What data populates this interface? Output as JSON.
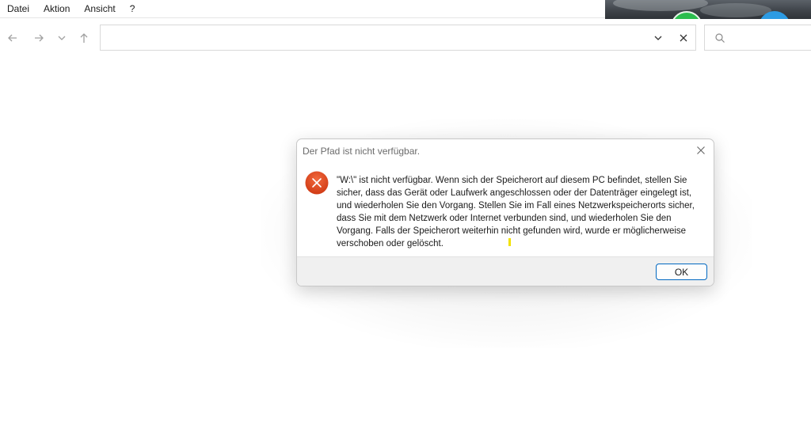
{
  "menubar": {
    "items": [
      "Datei",
      "Aktion",
      "Ansicht",
      "?"
    ]
  },
  "toolbar": {
    "back_icon": "arrow-left-icon",
    "forward_icon": "arrow-right-icon",
    "recent_icon": "chevron-down-icon",
    "up_icon": "arrow-up-icon"
  },
  "address": {
    "value": "",
    "dropdown_icon": "chevron-down-icon",
    "clear_icon": "close-icon"
  },
  "search": {
    "value": "",
    "icon": "search-icon"
  },
  "dialog": {
    "title": "Der Pfad ist nicht verfügbar.",
    "close_icon": "close-icon",
    "icon": "error-icon",
    "message": "\"W:\\\" ist nicht verfügbar. Wenn sich der Speicherort auf diesem PC befindet, stellen Sie sicher, dass das Gerät oder Laufwerk angeschlossen oder der Datenträger eingelegt ist, und wiederholen Sie den Vorgang. Stellen Sie im Fall eines Netzwerkspeicherorts sicher, dass Sie mit dem Netzwerk oder Internet verbunden sind, und wiederholen Sie den Vorgang. Falls der Speicherort weiterhin nicht gefunden wird, wurde er möglicherweise verschoben oder gelöscht.",
    "ok_label": "OK"
  },
  "colors": {
    "error_red": "#e0461e",
    "accent": "#0067c0",
    "caret_yellow": "#f2e200"
  }
}
